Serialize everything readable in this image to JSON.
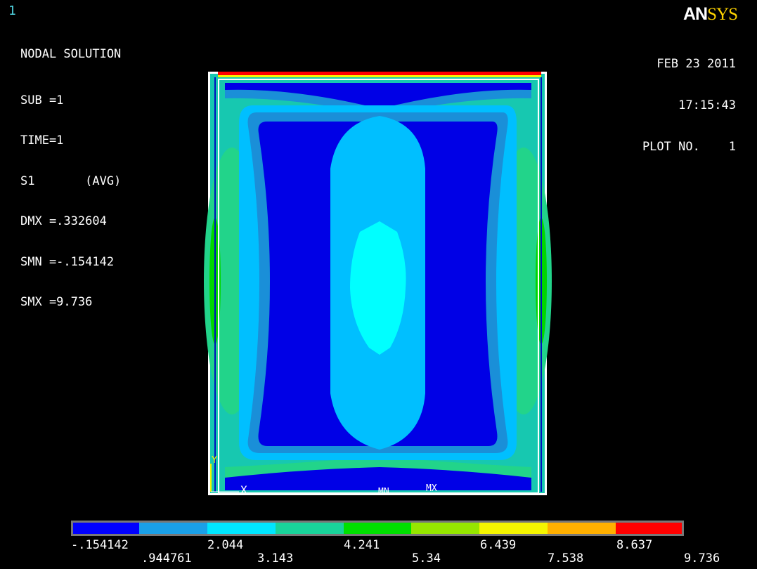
{
  "window_number": "1",
  "logo": {
    "part1": "AN",
    "part2": "SYS"
  },
  "info": {
    "title": "NODAL SOLUTION",
    "lines": [
      "SUB =1",
      "TIME=1",
      "S1       (AVG)",
      "DMX =.332604",
      "SMN =-.154142",
      "SMX =9.736"
    ]
  },
  "date_block": {
    "date": "FEB 23 2011",
    "time": "17:15:43",
    "plot_no": "PLOT NO.    1"
  },
  "plot_labels": {
    "x_axis": "X",
    "y_axis": "Y",
    "min_marker": "MN",
    "max_marker": "MX"
  },
  "legend": {
    "colors": [
      "#0000ff",
      "#1aa0e8",
      "#00e6ff",
      "#19d39a",
      "#00e000",
      "#96e600",
      "#f5f500",
      "#ffb000",
      "#ff0000"
    ],
    "top_values": [
      "-.154142",
      "2.044",
      "4.241",
      "6.439",
      "8.637"
    ],
    "bottom_values": [
      ".944761",
      "3.143",
      "5.34",
      "7.538",
      "9.736"
    ]
  },
  "contour_colors": {
    "band1": "#0000e6",
    "band2": "#1a8fd8",
    "band3": "#00bfff",
    "band4": "#17c8b0",
    "band5": "#22d48a",
    "band6": "#00ffff",
    "edge_green": "#00d600"
  }
}
